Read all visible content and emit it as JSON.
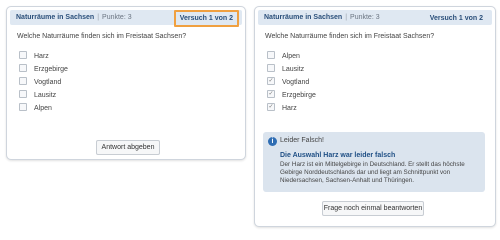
{
  "left": {
    "title": "Naturräume in Sachsen",
    "separator": "|",
    "points": "Punkte: 3",
    "attempt": "Versuch 1 von 2",
    "question": "Welche Naturräume finden sich im Freistaat Sachsen?",
    "options": [
      {
        "label": "Harz",
        "checked": false
      },
      {
        "label": "Erzgebirge",
        "checked": false
      },
      {
        "label": "Vogtland",
        "checked": false
      },
      {
        "label": "Lausitz",
        "checked": false
      },
      {
        "label": "Alpen",
        "checked": false
      }
    ],
    "submit_label": "Antwort abgeben"
  },
  "right": {
    "title": "Naturräume in Sachsen",
    "separator": "|",
    "points": "Punkte: 3",
    "attempt": "Versuch 1 von 2",
    "question": "Welche Naturräume finden sich im Freistaat Sachsen?",
    "options": [
      {
        "label": "Alpen",
        "checked": false
      },
      {
        "label": "Lausitz",
        "checked": false
      },
      {
        "label": "Vogtland",
        "checked": true
      },
      {
        "label": "Erzgebirge",
        "checked": true
      },
      {
        "label": "Harz",
        "checked": true
      }
    ],
    "feedback": {
      "icon": "info-icon",
      "status": "Leider Falsch!",
      "title": "Die Auswahl Harz war leider falsch",
      "text": "Der Harz ist ein Mittelgebirge in Deutschland. Er stellt das höchste Gebirge Norddeutschlands dar und liegt am Schnittpunkt von Niedersachsen, Sachsen-Anhalt und Thüringen."
    },
    "retry_label": "Frage noch einmal beantworten"
  },
  "colors": {
    "accent_orange": "#f0a040",
    "header_bg": "#dfe8f2",
    "title_blue": "#2a4f7a",
    "info_blue": "#2f6db3"
  }
}
